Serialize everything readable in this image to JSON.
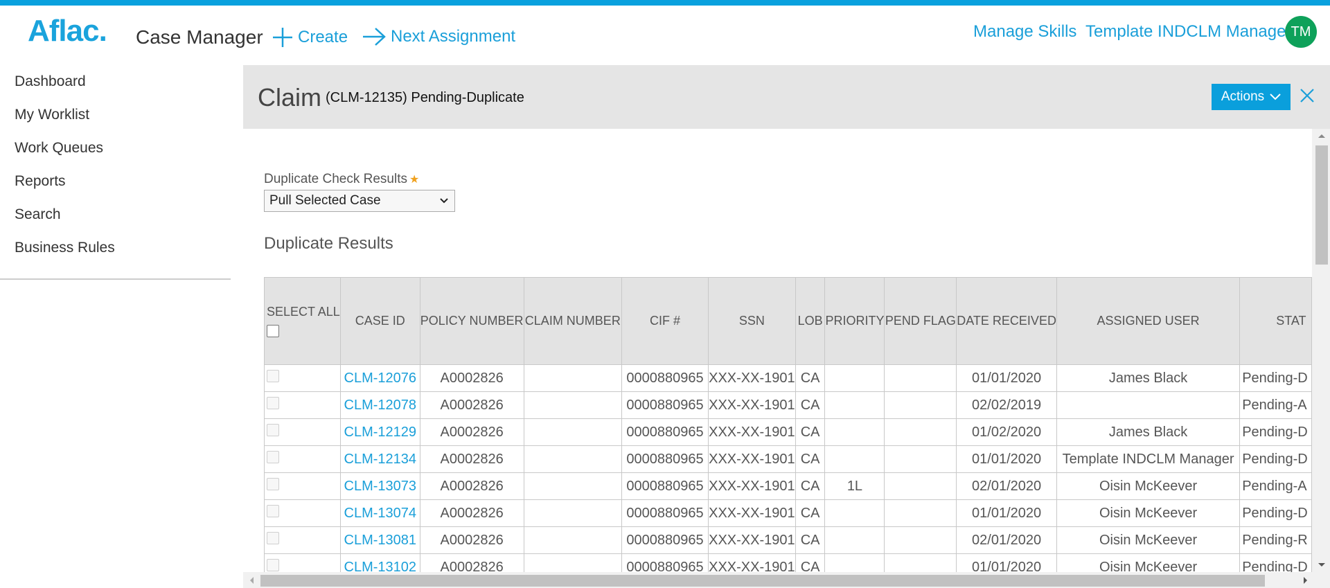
{
  "header": {
    "logo": "Aflac.",
    "app_title": "Case Manager",
    "create_label": "Create",
    "next_label": "Next Assignment",
    "manage_skills_label": "Manage Skills",
    "user_name": "Template INDCLM Manager",
    "avatar_initials": "TM"
  },
  "sidebar": {
    "items": [
      {
        "label": "Dashboard"
      },
      {
        "label": "My Worklist"
      },
      {
        "label": "Work Queues"
      },
      {
        "label": "Reports"
      },
      {
        "label": "Search"
      },
      {
        "label": "Business Rules"
      }
    ]
  },
  "case": {
    "type_label": "Claim",
    "subtitle": "(CLM-12135) Pending-Duplicate",
    "actions_label": "Actions"
  },
  "form": {
    "dup_label": "Duplicate Check Results",
    "dup_value": "Pull Selected Case",
    "section_title": "Duplicate Results"
  },
  "table": {
    "select_all_label": "SELECT ALL",
    "columns": [
      "CASE ID",
      "POLICY NUMBER",
      "CLAIM NUMBER",
      "CIF #",
      "SSN",
      "LOB",
      "PRIORITY",
      "PEND FLAG",
      "DATE RECEIVED",
      "ASSIGNED USER",
      "STAT"
    ],
    "rows": [
      {
        "case_id": "CLM-12076",
        "policy": "A0002826",
        "claim": "",
        "cif": "0000880965",
        "ssn": "XXX-XX-1901",
        "lob": "CA",
        "priority": "",
        "pend": "",
        "date": "01/01/2020",
        "user": "James Black",
        "status": "Pending-D"
      },
      {
        "case_id": "CLM-12078",
        "policy": "A0002826",
        "claim": "",
        "cif": "0000880965",
        "ssn": "XXX-XX-1901",
        "lob": "CA",
        "priority": "",
        "pend": "",
        "date": "02/02/2019",
        "user": "",
        "status": "Pending-A"
      },
      {
        "case_id": "CLM-12129",
        "policy": "A0002826",
        "claim": "",
        "cif": "0000880965",
        "ssn": "XXX-XX-1901",
        "lob": "CA",
        "priority": "",
        "pend": "",
        "date": "01/02/2020",
        "user": "James Black",
        "status": "Pending-D"
      },
      {
        "case_id": "CLM-12134",
        "policy": "A0002826",
        "claim": "",
        "cif": "0000880965",
        "ssn": "XXX-XX-1901",
        "lob": "CA",
        "priority": "",
        "pend": "",
        "date": "01/01/2020",
        "user": "Template INDCLM Manager",
        "status": "Pending-D"
      },
      {
        "case_id": "CLM-13073",
        "policy": "A0002826",
        "claim": "",
        "cif": "0000880965",
        "ssn": "XXX-XX-1901",
        "lob": "CA",
        "priority": "1L",
        "pend": "",
        "date": "02/01/2020",
        "user": "Oisin McKeever",
        "status": "Pending-A"
      },
      {
        "case_id": "CLM-13074",
        "policy": "A0002826",
        "claim": "",
        "cif": "0000880965",
        "ssn": "XXX-XX-1901",
        "lob": "CA",
        "priority": "",
        "pend": "",
        "date": "01/01/2020",
        "user": "Oisin McKeever",
        "status": "Pending-D"
      },
      {
        "case_id": "CLM-13081",
        "policy": "A0002826",
        "claim": "",
        "cif": "0000880965",
        "ssn": "XXX-XX-1901",
        "lob": "CA",
        "priority": "",
        "pend": "",
        "date": "02/01/2020",
        "user": "Oisin McKeever",
        "status": "Pending-R"
      },
      {
        "case_id": "CLM-13102",
        "policy": "A0002826",
        "claim": "",
        "cif": "0000880965",
        "ssn": "XXX-XX-1901",
        "lob": "CA",
        "priority": "",
        "pend": "",
        "date": "01/01/2020",
        "user": "Oisin McKeever",
        "status": "Pending-D"
      }
    ]
  },
  "colors": {
    "accent": "#0aa1de",
    "link": "#1a9fd9",
    "avatar": "#0ea15a",
    "required": "#f0a11e"
  }
}
